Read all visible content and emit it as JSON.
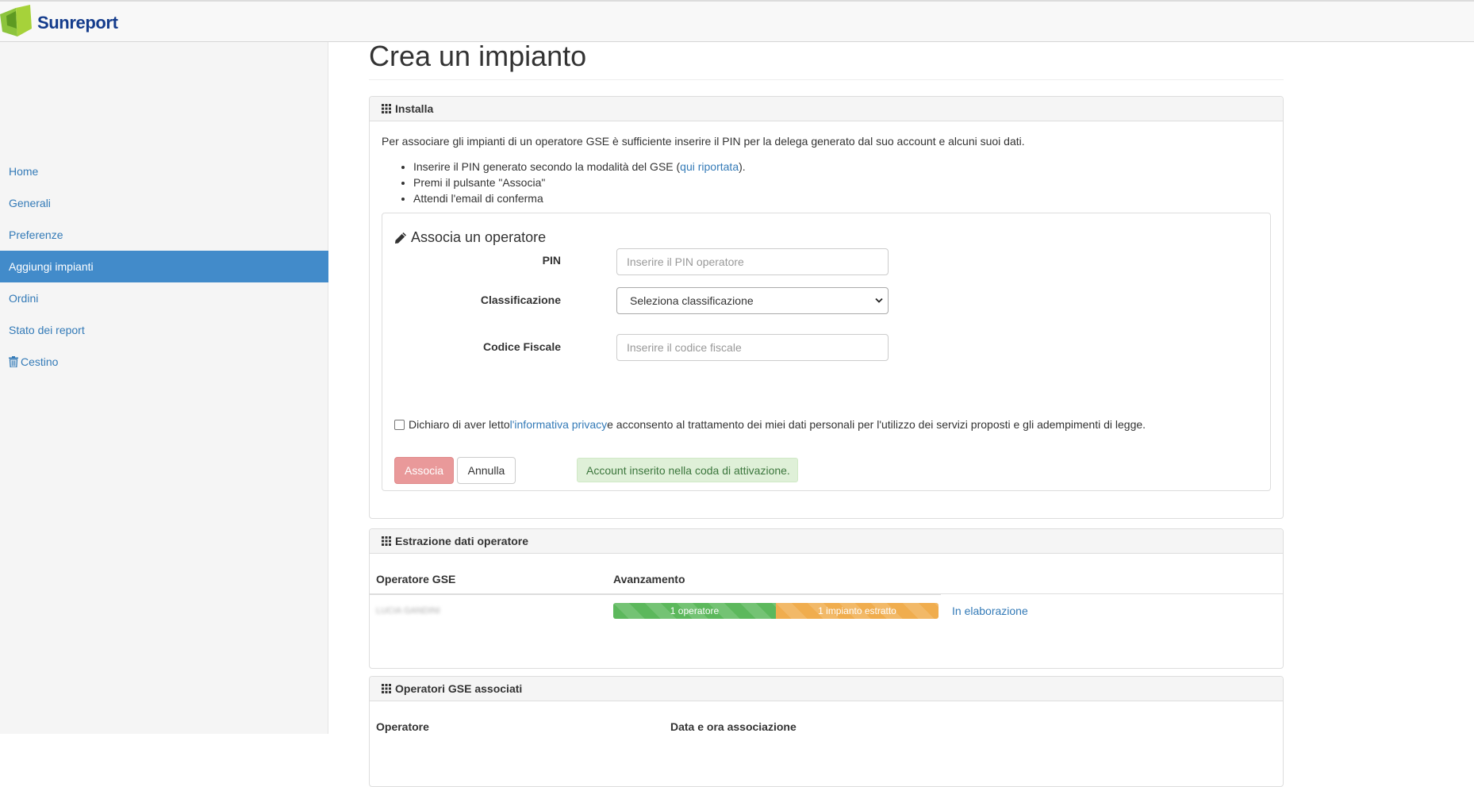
{
  "brand": {
    "name": "Sunreport"
  },
  "sidebar": {
    "items": [
      {
        "label": "Home",
        "active": false
      },
      {
        "label": "Generali",
        "active": false
      },
      {
        "label": "Preferenze",
        "active": false
      },
      {
        "label": "Aggiungi impianti",
        "active": true
      },
      {
        "label": "Ordini",
        "active": false
      },
      {
        "label": "Stato dei report",
        "active": false
      },
      {
        "label": "Cestino",
        "active": false,
        "icon": "trash-icon"
      }
    ]
  },
  "page": {
    "title": "Crea un impianto"
  },
  "install_panel": {
    "heading": "Installa",
    "intro": "Per associare gli impianti di un operatore GSE è sufficiente inserire il PIN per la delega generato dal suo account e alcuni suoi dati.",
    "step1_before": "Inserire il PIN generato secondo la modalità del GSE (",
    "step1_link": "qui riportata",
    "step1_after": ").",
    "step2": "Premi il pulsante \"Associa\"",
    "step3": "Attendi l'email di conferma"
  },
  "associate_form": {
    "title": "Associa un operatore",
    "pin_label": "PIN",
    "pin_placeholder": "Inserire il PIN operatore",
    "class_label": "Classificazione",
    "class_selected": "Seleziona classificazione",
    "cf_label": "Codice Fiscale",
    "cf_placeholder": "Inserire il codice fiscale",
    "privacy_before": "Dichiaro di aver letto ",
    "privacy_link": "l'informativa privacy",
    "privacy_after": " e acconsento al trattamento dei miei dati personali per l'utilizzo dei servizi proposti e gli adempimenti di legge.",
    "privacy_checked": false,
    "associa_button": "Associa",
    "annulla_button": "Annulla",
    "success_message": "Account inserito nella coda di attivazione."
  },
  "extraction_panel": {
    "heading": "Estrazione dati operatore",
    "col_operator": "Operatore GSE",
    "col_progress": "Avanzamento",
    "row": {
      "operator": "LUCIA GANDINI",
      "bar1_label": "1 operatore",
      "bar1_fraction": 0.5,
      "bar2_label": "1 impianto estratto",
      "bar2_fraction": 0.5,
      "status": "In elaborazione"
    }
  },
  "associated_panel": {
    "heading": "Operatori GSE associati",
    "col_operator": "Operatore",
    "col_date": "Data e ora associazione"
  },
  "colors": {
    "active_nav": "#428bca",
    "link": "#337ab7",
    "success_bg": "#dff0d8",
    "progress_green": "#5cb85c",
    "progress_orange": "#f0ad4e",
    "associa_button": "#e9999a"
  }
}
